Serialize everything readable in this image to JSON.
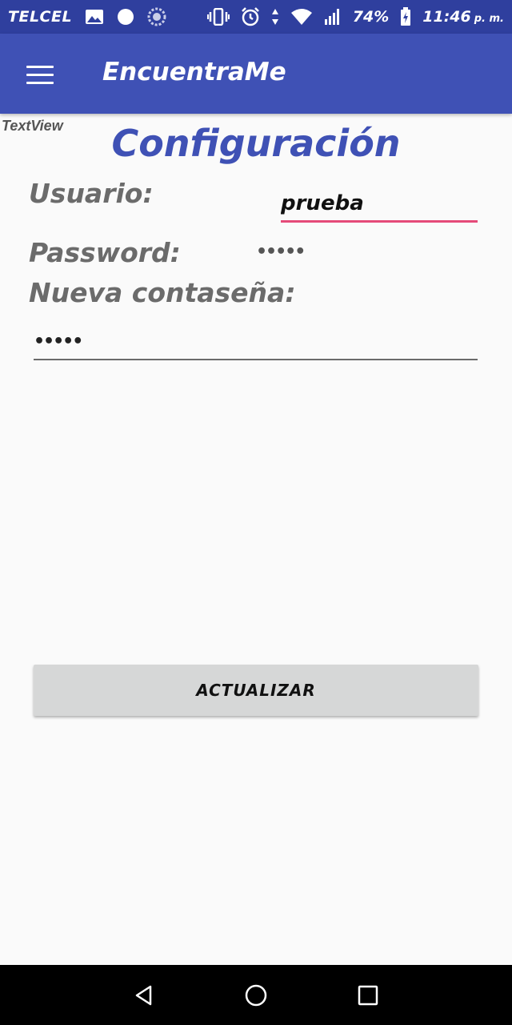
{
  "status_bar": {
    "carrier": "TELCEL",
    "battery": "74%",
    "time": "11:46",
    "time_suffix": "p. m.",
    "icons": [
      "image-icon",
      "circle-icon",
      "sync-icon",
      "vibrate-icon",
      "alarm-icon",
      "data-arrows-icon",
      "wifi-icon",
      "signal-icon",
      "battery-charging-icon"
    ]
  },
  "app_bar": {
    "title": "EncuentraMe",
    "menu_icon": "hamburger-menu-icon"
  },
  "content": {
    "debug_label": "TextView",
    "title": "Configuración",
    "username_label": "Usuario:",
    "username_value": "prueba",
    "password_label": "Password:",
    "password_value": "•••••",
    "new_password_label": "Nueva contaseña:",
    "new_password_value": "•••••",
    "update_button": "ACTUALIZAR"
  },
  "nav_bar": {
    "icons": [
      "back-icon",
      "home-icon",
      "recents-icon"
    ]
  },
  "colors": {
    "status_bar": "#2f3f9e",
    "primary": "#3f51b5",
    "accent": "#e54a79"
  }
}
